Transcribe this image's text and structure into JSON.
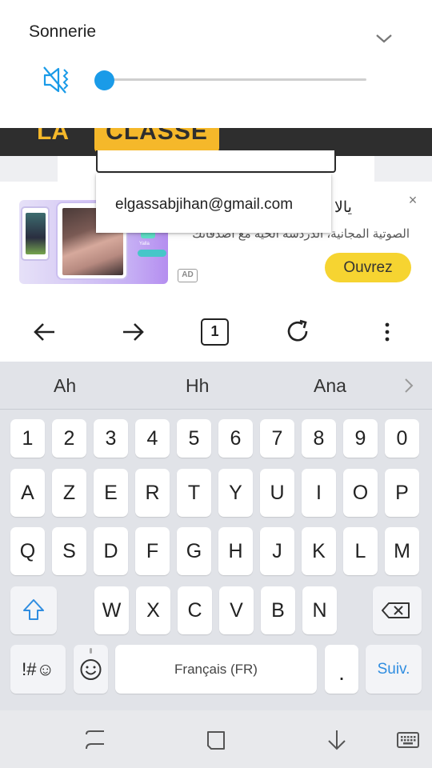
{
  "volume_panel": {
    "title": "Sonnerie",
    "level_percent": 0,
    "accent_color": "#1a9be8",
    "icon": "speaker-muted-icon"
  },
  "webpage": {
    "logo_text_left": "LA",
    "logo_text": "CLASSE"
  },
  "autofill": {
    "email": "elgassabjihan@gmail.com"
  },
  "ad": {
    "title": "يالا",
    "description": "الصوتية المجانية، الدردشة الحية مع أصدقائك",
    "badge": "AD",
    "cta": "Ouvrez",
    "close": "×",
    "image_yalla": "Yalla"
  },
  "browser_nav": {
    "back_icon": "arrow-left-icon",
    "forward_icon": "arrow-right-icon",
    "tabs_count": "1",
    "reload_icon": "reload-icon",
    "menu_icon": "more-vertical-icon"
  },
  "keyboard": {
    "suggestions": [
      "Ah",
      "Hh",
      "Ana"
    ],
    "number_row": [
      "1",
      "2",
      "3",
      "4",
      "5",
      "6",
      "7",
      "8",
      "9",
      "0"
    ],
    "row1": [
      "A",
      "Z",
      "E",
      "R",
      "T",
      "Y",
      "U",
      "I",
      "O",
      "P"
    ],
    "row2": [
      "Q",
      "S",
      "D",
      "F",
      "G",
      "H",
      "J",
      "K",
      "L",
      "M"
    ],
    "row3": [
      "W",
      "X",
      "C",
      "V",
      "B",
      "N"
    ],
    "symbols_label": "!#☺",
    "space_label": "Français (FR)",
    "period_label": ".",
    "next_label": "Suiv.",
    "background": "#e1e3e8"
  },
  "system_nav": {
    "recents_icon": "recents-icon",
    "home_icon": "home-icon",
    "back_icon": "down-arrow-icon",
    "keyboard_icon": "keyboard-icon"
  }
}
